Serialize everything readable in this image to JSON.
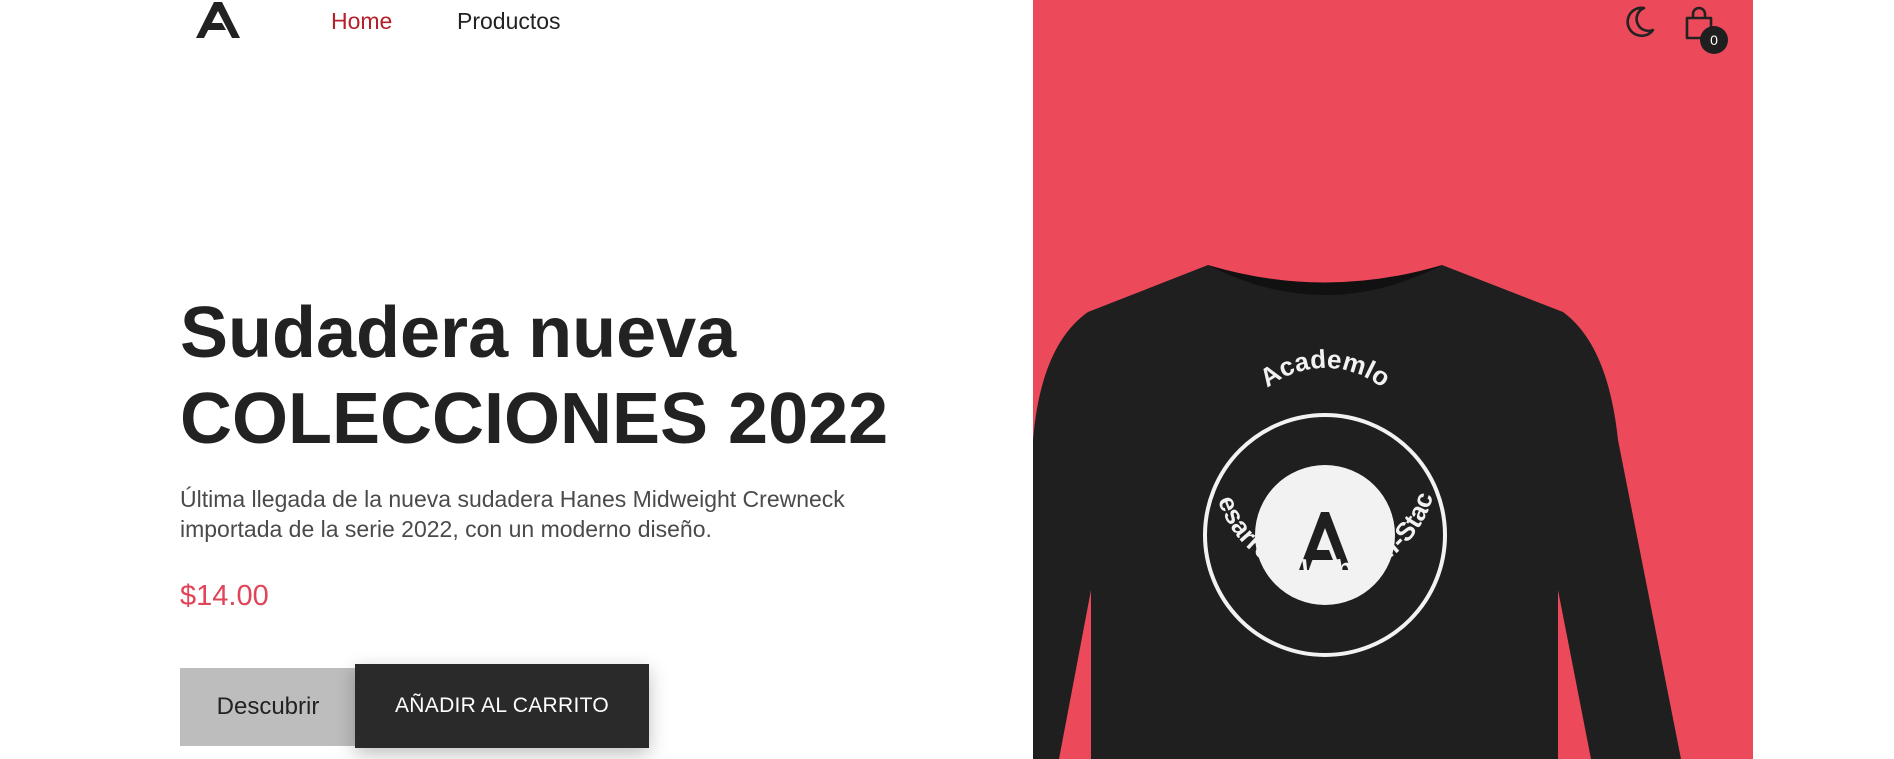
{
  "header": {
    "logo_icon": "academlo-logo-icon",
    "nav": [
      {
        "label": "Home",
        "active": true
      },
      {
        "label": "Productos",
        "active": false
      }
    ],
    "theme_icon": "moon-icon",
    "cart_icon": "shopping-bag-icon",
    "cart_count": "0"
  },
  "hero": {
    "title_line1": "Sudadera nueva",
    "title_line2": "COLECCIONES 2022",
    "description": "Última llegada de la nueva sudadera Hanes Midweight Crewneck importada de la serie 2022, con un moderno diseño.",
    "price": "$14.00",
    "discover_label": "Descubrir",
    "add_to_cart_label": "AÑADIR AL CARRITO"
  },
  "product_image": {
    "background_color": "#ec4a5a",
    "garment_color": "#1f1f1f",
    "badge_top_text": "Academlo",
    "badge_bottom_text": "Desarrollo Web Full-Stack"
  },
  "colors": {
    "active_nav": "#b3202a",
    "price": "#e04458",
    "dark_button": "#2a2a2a",
    "light_button": "#bdbdbd"
  }
}
